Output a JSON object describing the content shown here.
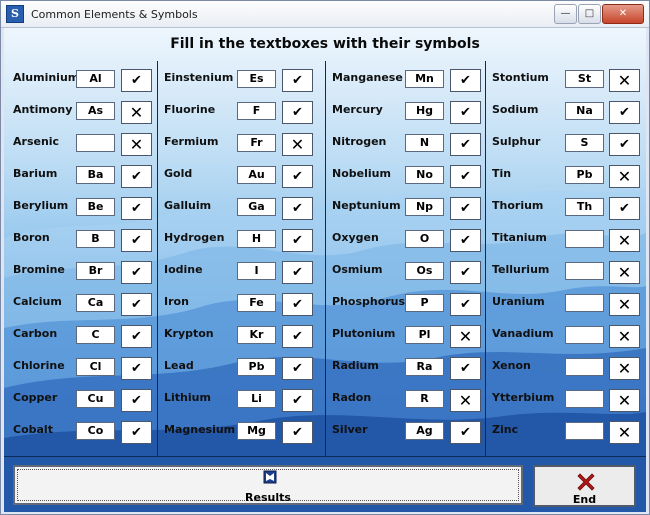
{
  "window": {
    "title": "Common Elements & Symbols",
    "app_icon": "S",
    "minimize_glyph": "—",
    "maximize_glyph": "□",
    "close_glyph": "✕"
  },
  "heading": "Fill in the textboxes with their symbols",
  "columns": [
    [
      {
        "name": "Aluminium",
        "symbol": "Al",
        "mark": "✔"
      },
      {
        "name": "Antimony",
        "symbol": "As",
        "mark": "✕"
      },
      {
        "name": "Arsenic",
        "symbol": "",
        "mark": "✕"
      },
      {
        "name": "Barium",
        "symbol": "Ba",
        "mark": "✔"
      },
      {
        "name": "Berylium",
        "symbol": "Be",
        "mark": "✔"
      },
      {
        "name": "Boron",
        "symbol": "B",
        "mark": "✔"
      },
      {
        "name": "Bromine",
        "symbol": "Br",
        "mark": "✔"
      },
      {
        "name": "Calcium",
        "symbol": "Ca",
        "mark": "✔"
      },
      {
        "name": "Carbon",
        "symbol": "C",
        "mark": "✔"
      },
      {
        "name": "Chlorine",
        "symbol": "Cl",
        "mark": "✔"
      },
      {
        "name": "Copper",
        "symbol": "Cu",
        "mark": "✔"
      },
      {
        "name": "Cobalt",
        "symbol": "Co",
        "mark": "✔"
      }
    ],
    [
      {
        "name": "Einstenium",
        "symbol": "Es",
        "mark": "✔"
      },
      {
        "name": "Fluorine",
        "symbol": "F",
        "mark": "✔"
      },
      {
        "name": "Fermium",
        "symbol": "Fr",
        "mark": "✕"
      },
      {
        "name": "Gold",
        "symbol": "Au",
        "mark": "✔"
      },
      {
        "name": "Galluim",
        "symbol": "Ga",
        "mark": "✔"
      },
      {
        "name": "Hydrogen",
        "symbol": "H",
        "mark": "✔"
      },
      {
        "name": "Iodine",
        "symbol": "I",
        "mark": "✔"
      },
      {
        "name": "Iron",
        "symbol": "Fe",
        "mark": "✔"
      },
      {
        "name": "Krypton",
        "symbol": "Kr",
        "mark": "✔"
      },
      {
        "name": "Lead",
        "symbol": "Pb",
        "mark": "✔"
      },
      {
        "name": "Lithium",
        "symbol": "Li",
        "mark": "✔"
      },
      {
        "name": "Magnesium",
        "symbol": "Mg",
        "mark": "✔"
      }
    ],
    [
      {
        "name": "Manganese",
        "symbol": "Mn",
        "mark": "✔"
      },
      {
        "name": "Mercury",
        "symbol": "Hg",
        "mark": "✔"
      },
      {
        "name": "Nitrogen",
        "symbol": "N",
        "mark": "✔"
      },
      {
        "name": "Nobelium",
        "symbol": "No",
        "mark": "✔"
      },
      {
        "name": "Neptunium",
        "symbol": "Np",
        "mark": "✔"
      },
      {
        "name": "Oxygen",
        "symbol": "O",
        "mark": "✔"
      },
      {
        "name": "Osmium",
        "symbol": "Os",
        "mark": "✔"
      },
      {
        "name": "Phosphorus",
        "symbol": "P",
        "mark": "✔"
      },
      {
        "name": "Plutonium",
        "symbol": "Pl",
        "mark": "✕"
      },
      {
        "name": "Radium",
        "symbol": "Ra",
        "mark": "✔"
      },
      {
        "name": "Radon",
        "symbol": "R",
        "mark": "✕"
      },
      {
        "name": "Silver",
        "symbol": "Ag",
        "mark": "✔"
      }
    ],
    [
      {
        "name": "Stontium",
        "symbol": "St",
        "mark": "✕"
      },
      {
        "name": "Sodium",
        "symbol": "Na",
        "mark": "✔"
      },
      {
        "name": "Sulphur",
        "symbol": "S",
        "mark": "✔"
      },
      {
        "name": "Tin",
        "symbol": "Pb",
        "mark": "✕"
      },
      {
        "name": "Thorium",
        "symbol": "Th",
        "mark": "✔"
      },
      {
        "name": "Titanium",
        "symbol": "",
        "mark": "✕"
      },
      {
        "name": "Tellurium",
        "symbol": "",
        "mark": "✕"
      },
      {
        "name": "Uranium",
        "symbol": "",
        "mark": "✕"
      },
      {
        "name": "Vanadium",
        "symbol": "",
        "mark": "✕"
      },
      {
        "name": "Xenon",
        "symbol": "",
        "mark": "✕"
      },
      {
        "name": "Ytterbium",
        "symbol": "",
        "mark": "✕"
      },
      {
        "name": "Zinc",
        "symbol": "",
        "mark": "✕"
      }
    ]
  ],
  "buttons": {
    "results_label": "Results",
    "results_icon": "book-icon",
    "end_label": "End",
    "end_icon": "red-x-icon"
  },
  "colors": {
    "end_icon_red": "#b01818",
    "results_icon_blue": "#1a3d8c"
  }
}
